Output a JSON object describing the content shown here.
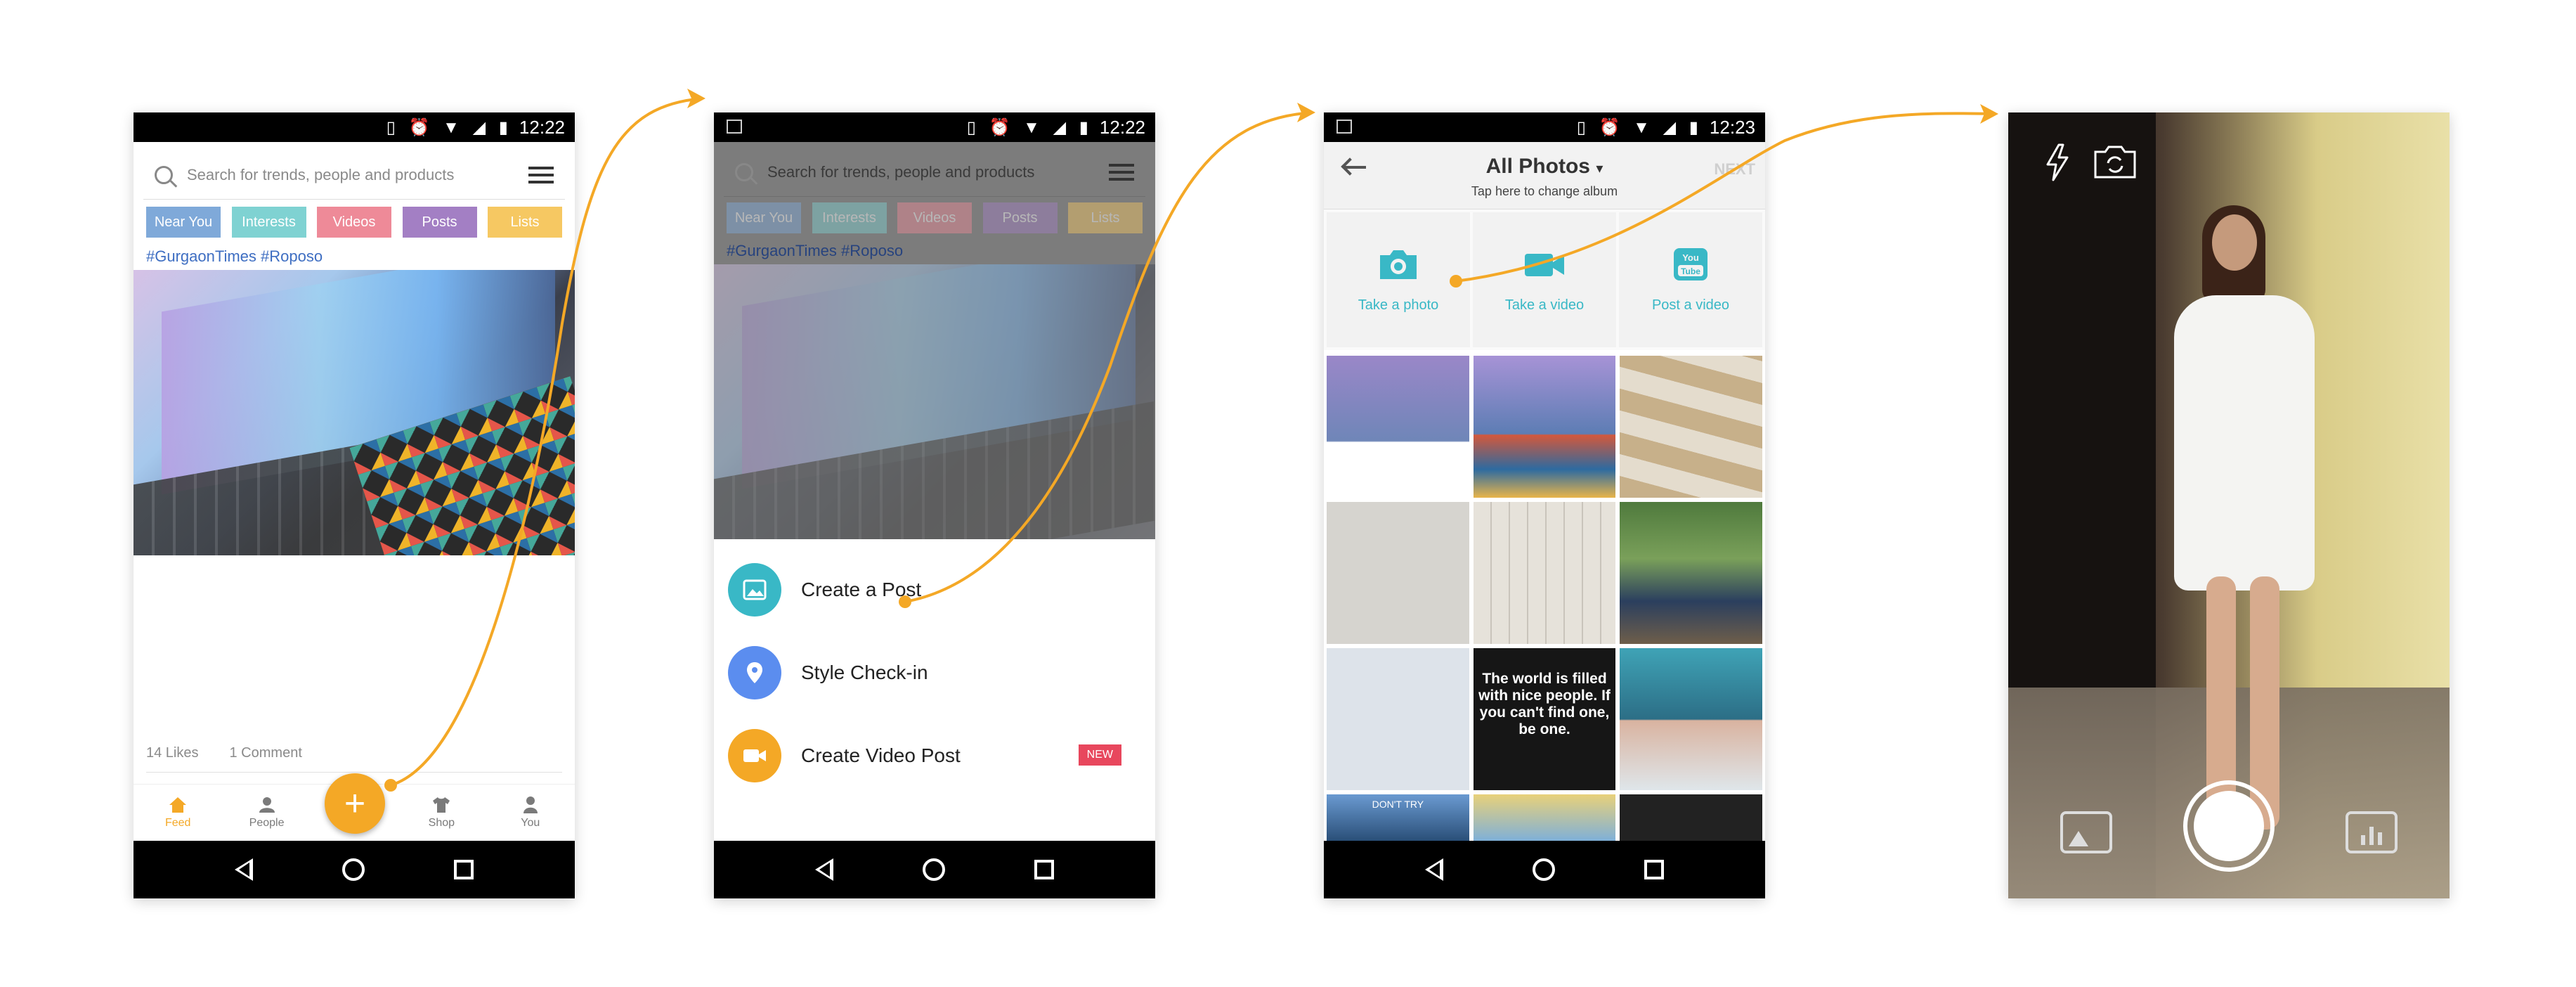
{
  "colors": {
    "accent": "#f4a826",
    "teal": "#39b8c6",
    "chip_near": "#7fa9d9",
    "chip_interests": "#7fd2d2",
    "chip_videos": "#ee8a98",
    "chip_posts": "#a37fc4",
    "chip_lists": "#f6c862",
    "new_badge": "#e8475d"
  },
  "screen1": {
    "time": "12:22",
    "search_placeholder": "Search for trends, people and products",
    "chips": [
      {
        "label": "Near You",
        "color": "#7fa9d9"
      },
      {
        "label": "Interests",
        "color": "#7fd2d2"
      },
      {
        "label": "Videos",
        "color": "#ee8a98"
      },
      {
        "label": "Posts",
        "color": "#a37fc4"
      },
      {
        "label": "Lists",
        "color": "#f6c862"
      }
    ],
    "hashtags": "#GurgaonTimes #Roposo",
    "likes": "14 Likes",
    "comments": "1 Comment",
    "tabs": [
      {
        "label": "Feed",
        "icon": "home-icon"
      },
      {
        "label": "People",
        "icon": "people-icon"
      },
      {
        "label": "Shop",
        "icon": "shirt-icon"
      },
      {
        "label": "You",
        "icon": "person-icon"
      }
    ],
    "fab_icon": "+"
  },
  "screen2": {
    "time": "12:22",
    "search_placeholder": "Search for trends, people and products",
    "hashtags": "#GurgaonTimes #Roposo",
    "chips": [
      "Near You",
      "Interests",
      "Videos",
      "Posts",
      "Lists"
    ],
    "menu": [
      {
        "label": "Create a Post",
        "icon": "image-icon",
        "color": "#39b8c6"
      },
      {
        "label": "Style Check-in",
        "icon": "location-pin-icon",
        "color": "#5b8def"
      },
      {
        "label": "Create Video Post",
        "icon": "video-camera-icon",
        "color": "#f4a826",
        "badge": "NEW"
      }
    ]
  },
  "screen3": {
    "time": "12:23",
    "title": "All Photos",
    "subtitle": "Tap here to change album",
    "next": "NEXT",
    "capture": [
      {
        "label": "Take a photo",
        "icon": "camera-icon"
      },
      {
        "label": "Take a video",
        "icon": "video-camera-icon"
      },
      {
        "label": "Post a video",
        "icon": "youtube-icon"
      }
    ],
    "quote": "The world is filled with nice people. If you can't find one, be one.",
    "bottom_captions": [
      "DON'T TRY",
      "",
      ""
    ]
  },
  "screen4": {
    "top_icons": [
      "flash-icon",
      "switch-camera-icon"
    ],
    "bottom_icons": [
      "gallery-icon",
      "shutter-button",
      "filter-icon"
    ]
  }
}
